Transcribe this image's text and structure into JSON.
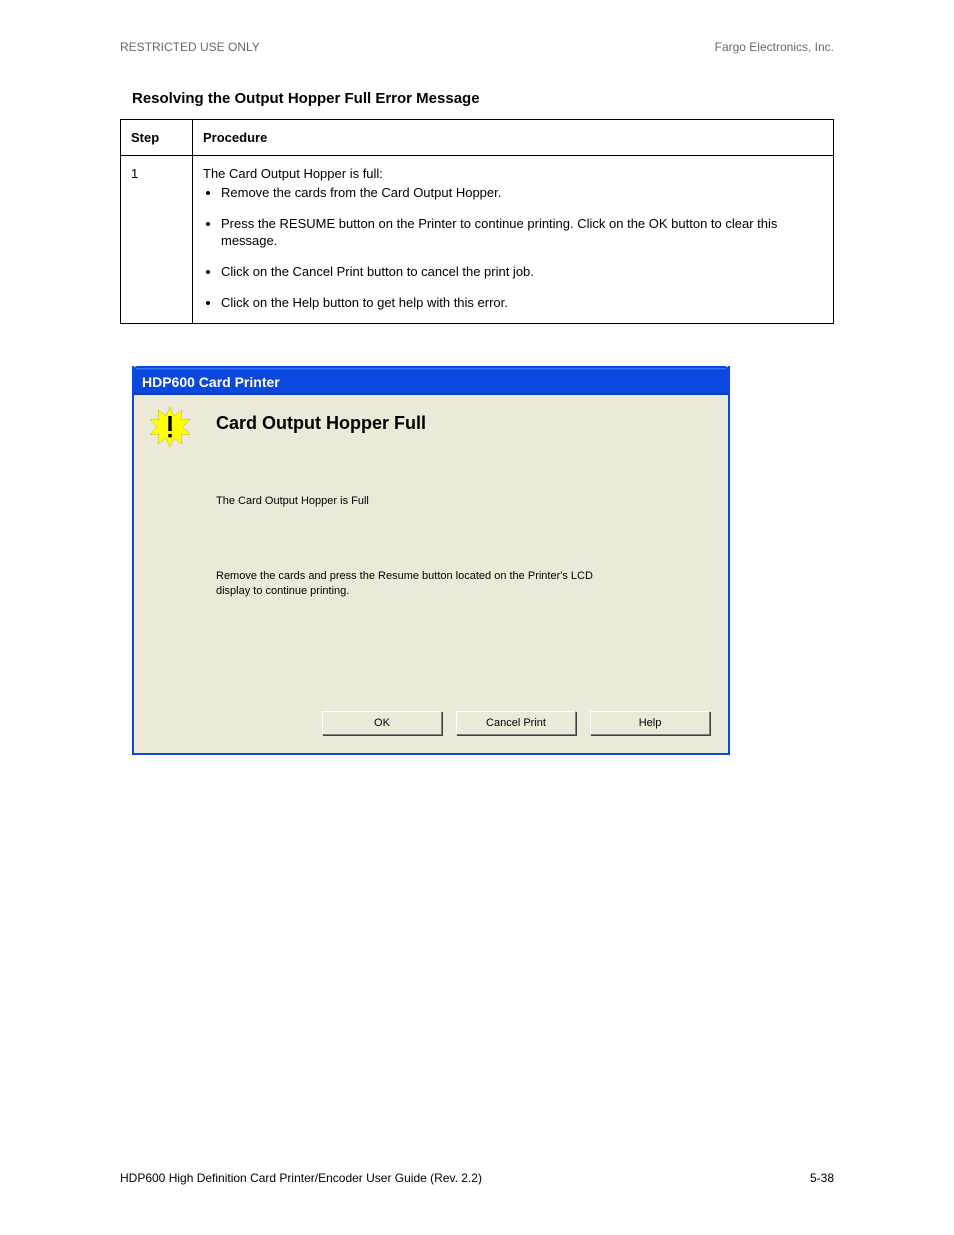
{
  "doc_header": "RESTRICTED USE ONLY",
  "product_name": "Fargo Electronics, Inc.",
  "section_title": "Resolving the Output Hopper Full Error Message",
  "table": {
    "h1": "Step",
    "h2": "Procedure",
    "step": "1",
    "proc_intro": "The Card Output Hopper is full:",
    "bullets": [
      "Remove the cards from the Card Output Hopper.",
      "Press the RESUME button on the Printer to continue printing. Click on the OK button to clear this message.",
      "Click on the Cancel Print button to cancel the print job.",
      "Click on the Help button to get help with this error."
    ]
  },
  "dialog": {
    "title": "HDP600 Card Printer",
    "heading": "Card Output Hopper Full",
    "line1": "The Card Output Hopper is Full",
    "line2": "Remove the cards and press the Resume button located on the Printer's LCD display to continue printing.",
    "buttons": {
      "ok": "OK",
      "cancel": "Cancel Print",
      "help": "Help"
    }
  },
  "footer": {
    "left": "HDP600 High Definition Card Printer/Encoder User Guide (Rev. 2.2)",
    "right": "5-38"
  }
}
